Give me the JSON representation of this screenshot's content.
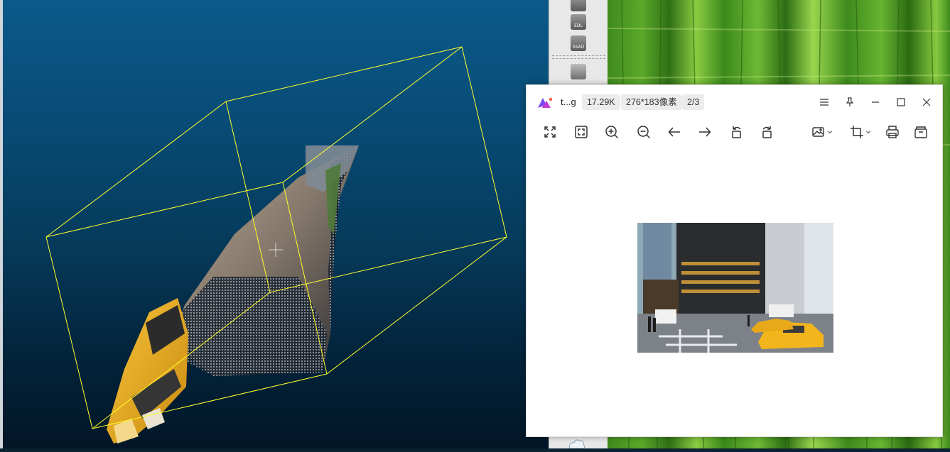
{
  "viewer": {
    "file_name": "t...g",
    "file_size": "17.29K",
    "dimensions": "276*183像素",
    "page_index": "2/3"
  },
  "window_controls": [
    "menu-icon",
    "pin-icon",
    "minimize-icon",
    "maximize-icon",
    "close-icon"
  ],
  "toolbar": [
    "fit-window-icon",
    "actual-size-icon",
    "zoom-in-icon",
    "zoom-out-icon",
    "previous-arrow-icon",
    "next-arrow-icon",
    "rotate-left-icon",
    "rotate-right-icon",
    "edit-image-icon",
    "crop-icon",
    "print-icon",
    "open-folder-icon"
  ],
  "desktop_strip": {
    "icon_labels": [
      "EDL",
      "SSAO"
    ]
  },
  "colors": {
    "bounding_box": "#ffff2a",
    "viewport_top": "#0b5a8a",
    "viewport_bottom": "#021627",
    "taxi_yellow": "#f2b51c"
  }
}
